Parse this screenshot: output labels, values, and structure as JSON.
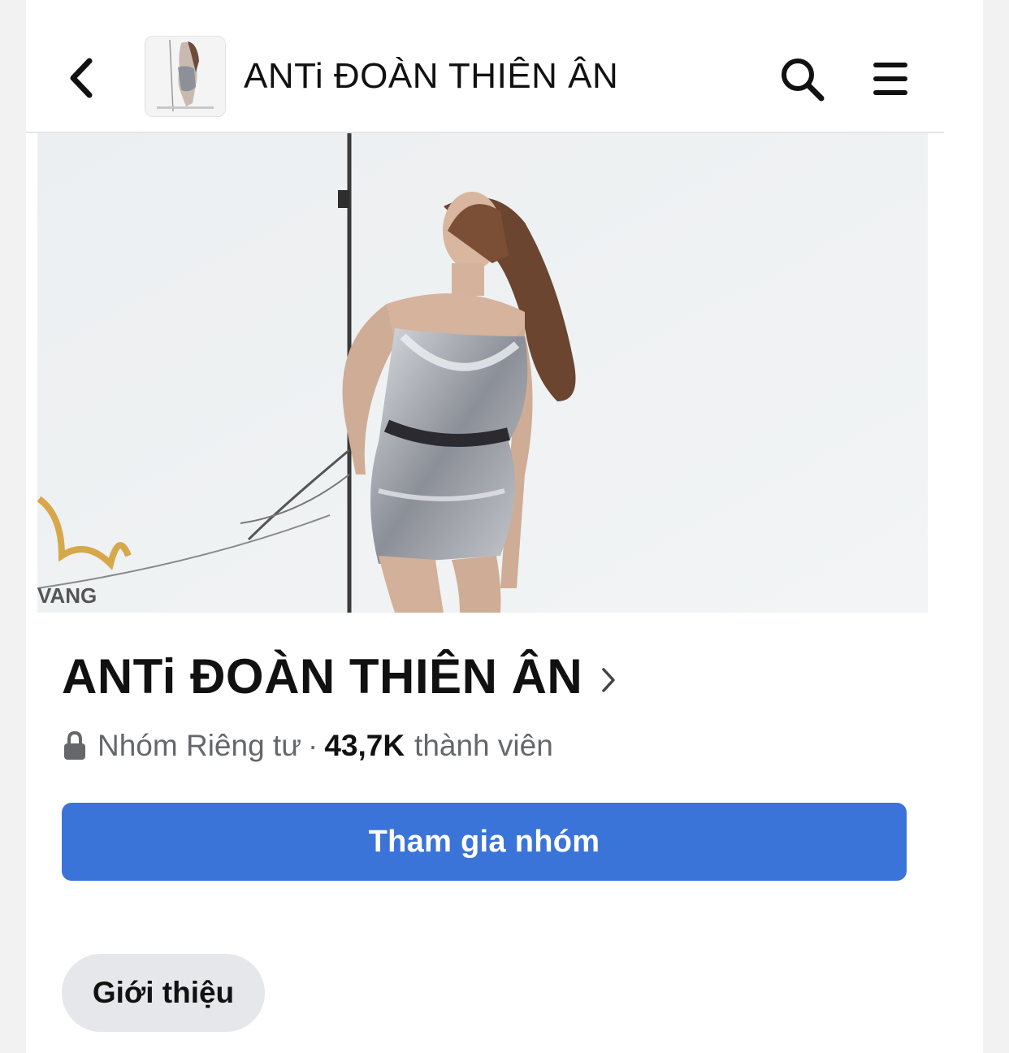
{
  "header": {
    "title": "ANTi ĐOÀN THIÊN ÂN",
    "back_icon": "chevron-left-icon",
    "search_icon": "search-icon",
    "menu_icon": "hamburger-menu-icon"
  },
  "cover": {
    "watermark": "VANG"
  },
  "group": {
    "name": "ANTi ĐOÀN THIÊN ÂN",
    "privacy_label": "Nhóm Riêng tư",
    "separator": "·",
    "member_count": "43,7K",
    "member_suffix": "thành viên"
  },
  "actions": {
    "join_label": "Tham gia nhóm",
    "intro_label": "Giới thiệu"
  },
  "colors": {
    "primary_button": "#3b74d8",
    "secondary_text": "#65676b",
    "chip_bg": "#e6e7ea"
  }
}
